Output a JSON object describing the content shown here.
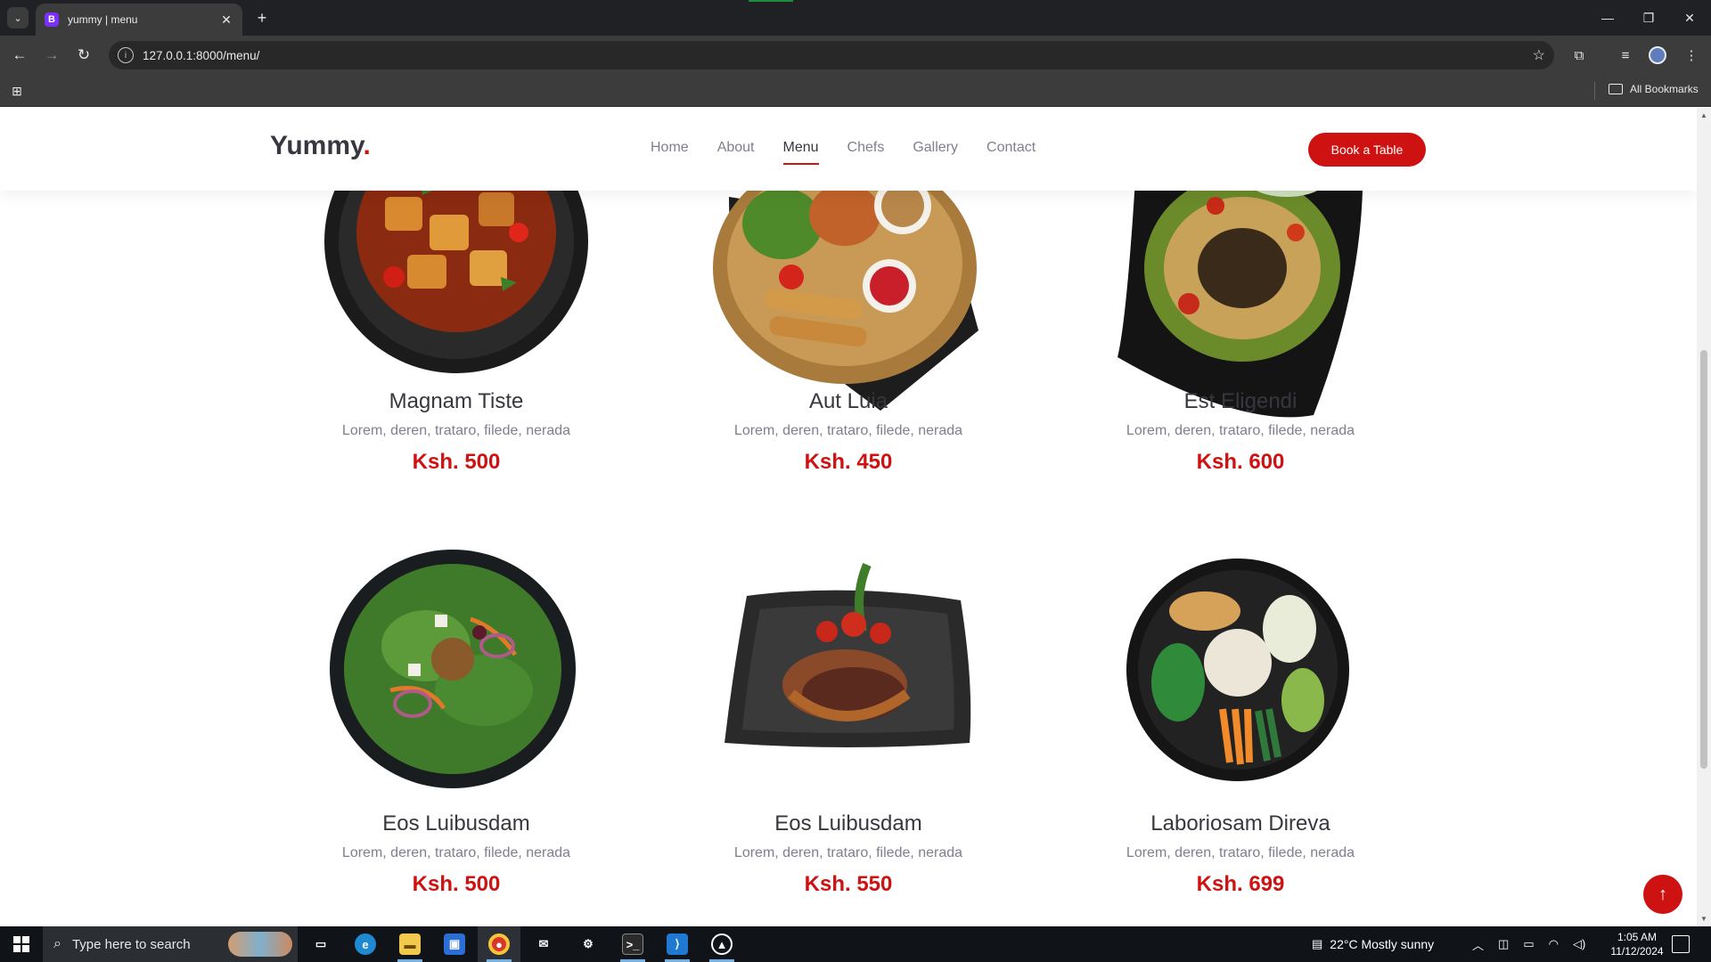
{
  "browser": {
    "tab_title": "yummy | menu",
    "tab_favicon_letter": "B",
    "tab_favicon_color": "#7b2ff7",
    "url": "127.0.0.1:8000/menu/",
    "bookmarks_label": "All Bookmarks"
  },
  "site": {
    "logo_text": "Yummy",
    "logo_dot": ".",
    "nav": [
      {
        "label": "Home",
        "active": false
      },
      {
        "label": "About",
        "active": false
      },
      {
        "label": "Menu",
        "active": true
      },
      {
        "label": "Chefs",
        "active": false
      },
      {
        "label": "Gallery",
        "active": false
      },
      {
        "label": "Contact",
        "active": false
      }
    ],
    "cta_label": "Book a Table",
    "accent_color": "#ce1212"
  },
  "menu_items": [
    {
      "name": "Magnam Tiste",
      "ingredients": "Lorem, deren, trataro, filede, nerada",
      "price": "Ksh. 500",
      "image": "tofu-bowl-image"
    },
    {
      "name": "Aut Luia",
      "ingredients": "Lorem, deren, trataro, filede, nerada",
      "price": "Ksh. 450",
      "image": "platter-image"
    },
    {
      "name": "Est Eligendi",
      "ingredients": "Lorem, deren, trataro, filede, nerada",
      "price": "Ksh. 600",
      "image": "papaya-salad-image"
    },
    {
      "name": "Eos Luibusdam",
      "ingredients": "Lorem, deren, trataro, filede, nerada",
      "price": "Ksh. 500",
      "image": "green-salad-image"
    },
    {
      "name": "Eos Luibusdam",
      "ingredients": "Lorem, deren, trataro, filede, nerada",
      "price": "Ksh. 550",
      "image": "steak-plate-image"
    },
    {
      "name": "Laboriosam Direva",
      "ingredients": "Lorem, deren, trataro, filede, nerada",
      "price": "Ksh. 699",
      "image": "poke-bowl-image"
    }
  ],
  "taskbar": {
    "search_placeholder": "Type here to search",
    "weather": "22°C  Mostly sunny",
    "time": "1:05 AM",
    "date": "11/12/2024"
  }
}
